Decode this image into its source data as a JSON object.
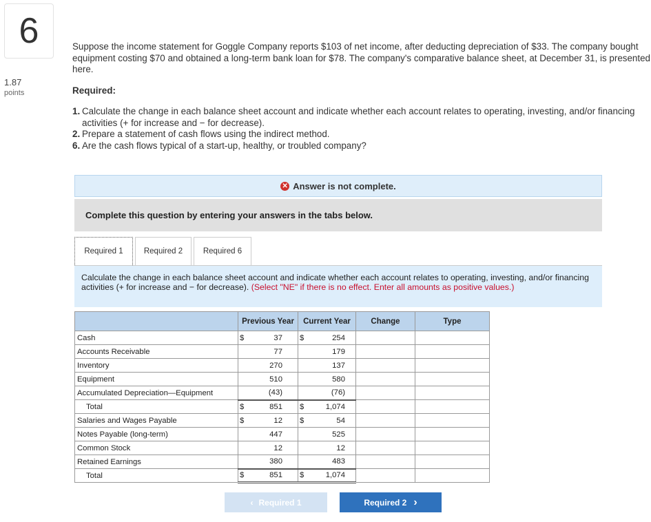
{
  "question": {
    "number": "6",
    "points_value": "1.87",
    "points_label": "points"
  },
  "intro": "Suppose the income statement for Goggle Company reports $103 of net income, after deducting depreciation of $33. The company bought equipment costing $70 and obtained a long-term bank loan for $78. The company's comparative balance sheet, at December 31, is presented here.",
  "required_heading": "Required:",
  "requirements": [
    {
      "num": "1.",
      "text": "Calculate the change in each balance sheet account and indicate whether each account relates to operating, investing, and/or financing activities (+ for increase and − for decrease)."
    },
    {
      "num": "2.",
      "text": "Prepare a statement of cash flows using the indirect method."
    },
    {
      "num": "6.",
      "text": "Are the cash flows typical of a start-up, healthy, or troubled company?"
    }
  ],
  "banner": {
    "icon": "x-circle-icon",
    "text": "Answer is not complete."
  },
  "complete_text": "Complete this question by entering your answers in the tabs below.",
  "tabs": [
    "Required 1",
    "Required 2",
    "Required 6"
  ],
  "instruction": {
    "main": "Calculate the change in each balance sheet account and indicate whether each account relates to operating, investing, and/or financing activities (+ for increase and − for decrease).",
    "red": "(Select \"NE\" if there is no effect. Enter all amounts as positive values.)"
  },
  "table": {
    "headers": {
      "prev": "Previous Year",
      "curr": "Current Year",
      "change": "Change",
      "type": "Type"
    },
    "rows": [
      {
        "account": "Cash",
        "prev_dollar": "$",
        "prev": "37",
        "curr_dollar": "$",
        "curr": "254"
      },
      {
        "account": "Accounts Receivable",
        "prev_dollar": "",
        "prev": "77",
        "curr_dollar": "",
        "curr": "179"
      },
      {
        "account": "Inventory",
        "prev_dollar": "",
        "prev": "270",
        "curr_dollar": "",
        "curr": "137"
      },
      {
        "account": "Equipment",
        "prev_dollar": "",
        "prev": "510",
        "curr_dollar": "",
        "curr": "580"
      },
      {
        "account": "Accumulated Depreciation—Equipment",
        "prev_dollar": "",
        "prev": "(43)",
        "curr_dollar": "",
        "curr": "(76)"
      },
      {
        "account": "Total",
        "prev_dollar": "$",
        "prev": "851",
        "curr_dollar": "$",
        "curr": "1,074"
      },
      {
        "account": "Salaries and Wages Payable",
        "prev_dollar": "$",
        "prev": "12",
        "curr_dollar": "$",
        "curr": "54"
      },
      {
        "account": "Notes Payable (long-term)",
        "prev_dollar": "",
        "prev": "447",
        "curr_dollar": "",
        "curr": "525"
      },
      {
        "account": "Common Stock",
        "prev_dollar": "",
        "prev": "12",
        "curr_dollar": "",
        "curr": "12"
      },
      {
        "account": "Retained Earnings",
        "prev_dollar": "",
        "prev": "380",
        "curr_dollar": "",
        "curr": "483"
      },
      {
        "account": "Total",
        "prev_dollar": "$",
        "prev": "851",
        "curr_dollar": "$",
        "curr": "1,074"
      }
    ]
  },
  "nav": {
    "prev_label": "Required 1",
    "prev_icon": "chevron-left-icon",
    "next_label": "Required 2",
    "next_icon": "chevron-right-icon"
  },
  "colors": {
    "accent": "#2f72bd",
    "header_bg": "#bcd4ec",
    "banner_bg": "#dfeefa",
    "error": "#d0312d",
    "instruction_red": "#c8102e"
  }
}
